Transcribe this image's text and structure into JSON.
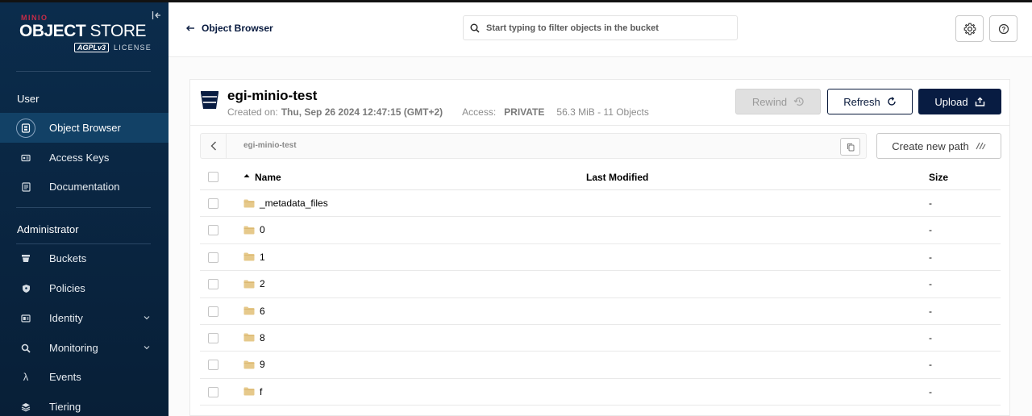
{
  "app": {
    "brand_small": "MINIO",
    "brand_strong": "OBJECT",
    "brand_light": "STORE",
    "license_badge": "AGPLv3",
    "license_text": "LICENSE"
  },
  "sidebar": {
    "user_section": "User",
    "admin_section": "Administrator",
    "user_items": [
      {
        "label": "Object Browser",
        "icon": "object-browser-icon",
        "active": true
      },
      {
        "label": "Access Keys",
        "icon": "access-keys-icon"
      },
      {
        "label": "Documentation",
        "icon": "documentation-icon"
      }
    ],
    "admin_items": [
      {
        "label": "Buckets",
        "icon": "buckets-icon"
      },
      {
        "label": "Policies",
        "icon": "policies-icon"
      },
      {
        "label": "Identity",
        "icon": "identity-icon",
        "expandable": true
      },
      {
        "label": "Monitoring",
        "icon": "monitoring-icon",
        "expandable": true
      },
      {
        "label": "Events",
        "icon": "lambda-icon"
      },
      {
        "label": "Tiering",
        "icon": "tiering-icon"
      }
    ]
  },
  "header": {
    "back_label": "Object Browser",
    "search_placeholder": "Start typing to filter objects in the bucket"
  },
  "bucket": {
    "name": "egi-minio-test",
    "created_label": "Created on:",
    "created_value": "Thu, Sep 26 2024 12:47:15 (GMT+2)",
    "access_label": "Access:",
    "access_value": "PRIVATE",
    "usage": "56.3 MiB - 11 Objects"
  },
  "actions": {
    "rewind": "Rewind",
    "refresh": "Refresh",
    "upload": "Upload",
    "create_path": "Create new path"
  },
  "path": {
    "current": "egi-minio-test"
  },
  "table": {
    "columns": {
      "name": "Name",
      "modified": "Last Modified",
      "size": "Size"
    },
    "sort": {
      "column": "name",
      "direction": "asc"
    },
    "rows": [
      {
        "name": "_metadata_files",
        "modified": "",
        "size": "-"
      },
      {
        "name": "0",
        "modified": "",
        "size": "-"
      },
      {
        "name": "1",
        "modified": "",
        "size": "-"
      },
      {
        "name": "2",
        "modified": "",
        "size": "-"
      },
      {
        "name": "6",
        "modified": "",
        "size": "-"
      },
      {
        "name": "8",
        "modified": "",
        "size": "-"
      },
      {
        "name": "9",
        "modified": "",
        "size": "-"
      },
      {
        "name": "f",
        "modified": "",
        "size": "-"
      }
    ]
  },
  "colors": {
    "sidebar_bg": "#0b2c4c",
    "sidebar_active": "#124166",
    "brand_accent": "#c72c48",
    "primary": "#081c42",
    "folder": "#e6c98b"
  }
}
